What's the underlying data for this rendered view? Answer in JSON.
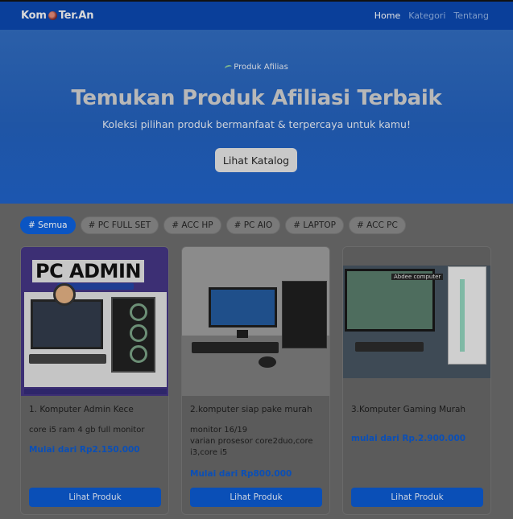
{
  "navbar": {
    "brand_left": "Kom",
    "brand_right": "Ter.An",
    "links": [
      {
        "label": "Home",
        "active": true
      },
      {
        "label": "Kategori",
        "active": false
      },
      {
        "label": "Tentang",
        "active": false
      }
    ]
  },
  "hero": {
    "badge": "Produk Afilias",
    "title": "Temukan Produk Afiliasi Terbaik",
    "subtitle": "Koleksi pilihan produk bermanfaat & terpercaya untuk kamu!",
    "button_label": "Lihat Katalog"
  },
  "filters": [
    {
      "label": "# Semua",
      "active": true
    },
    {
      "label": "# PC FULL SET",
      "active": false
    },
    {
      "label": "# ACC HP",
      "active": false
    },
    {
      "label": "# PC AIO",
      "active": false
    },
    {
      "label": "# LAPTOP",
      "active": false
    },
    {
      "label": "# ACC PC",
      "active": false
    }
  ],
  "products": [
    {
      "title": "1. Komputer Admin Kece",
      "description": "core i5 ram 4 gb full monitor",
      "price": "Mulai dari Rp2.150.000",
      "button_label": "Lihat Produk",
      "image_text": "PC ADMIN"
    },
    {
      "title": "2.komputer siap pake murah",
      "description": "monitor 16/19\nvarian prosesor core2duo,core i3,core i5",
      "price": "Mulai dari Rp800.000",
      "button_label": "Lihat Produk"
    },
    {
      "title": "3.Komputer Gaming Murah",
      "description": "",
      "price": "mulai dari Rp.2.900.000",
      "button_label": "Lihat Produk",
      "image_text": "Abdee computer"
    }
  ],
  "colors": {
    "navbar_bg": "#0a3f9a",
    "hero_bg": "#1f55a5",
    "accent": "#0b55c3",
    "price": "#0b4fb6"
  }
}
